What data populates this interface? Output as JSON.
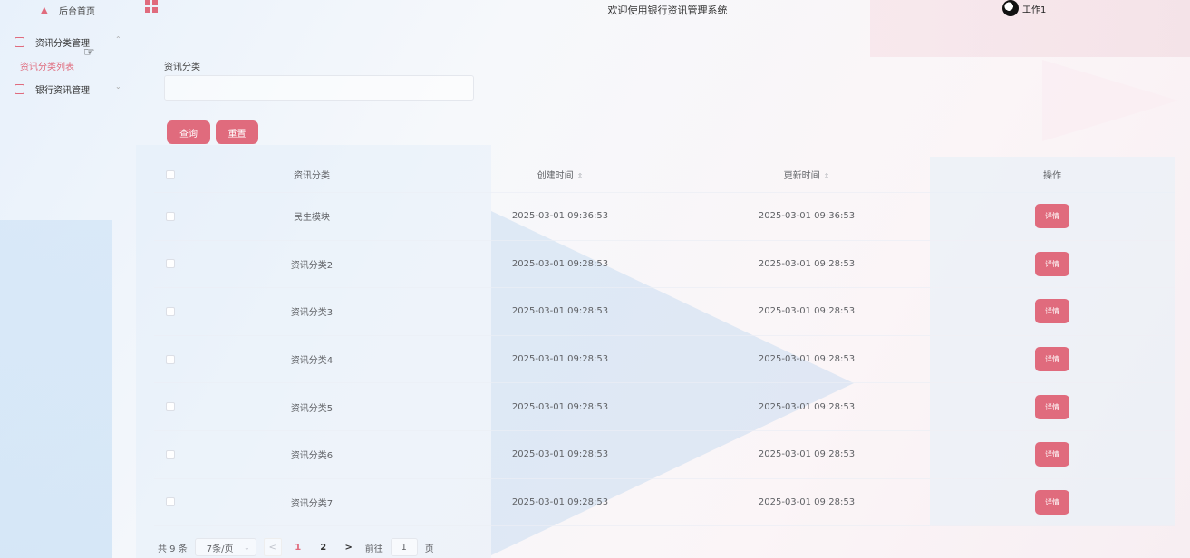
{
  "header": {
    "home_label": "后台首页",
    "site_title": "欢迎使用银行资讯管理系统",
    "user_name": "工作1"
  },
  "sidebar": {
    "items": [
      {
        "label": "资讯分类管理",
        "expanded": true,
        "children": [
          {
            "label": "资讯分类列表",
            "active": true
          }
        ]
      },
      {
        "label": "银行资讯管理",
        "expanded": false
      }
    ]
  },
  "search": {
    "label": "资讯分类",
    "value": "",
    "placeholder": ""
  },
  "buttons": {
    "query": "查询",
    "reset": "重置"
  },
  "table": {
    "columns": [
      "资讯分类",
      "创建时间",
      "更新时间",
      "操作"
    ],
    "sortable": [
      "创建时间",
      "更新时间"
    ],
    "detail_label": "详情",
    "rows": [
      {
        "category": "民生模块",
        "created": "2025-03-01 09:36:53",
        "updated": "2025-03-01 09:36:53"
      },
      {
        "category": "资讯分类2",
        "created": "2025-03-01 09:28:53",
        "updated": "2025-03-01 09:28:53"
      },
      {
        "category": "资讯分类3",
        "created": "2025-03-01 09:28:53",
        "updated": "2025-03-01 09:28:53"
      },
      {
        "category": "资讯分类4",
        "created": "2025-03-01 09:28:53",
        "updated": "2025-03-01 09:28:53"
      },
      {
        "category": "资讯分类5",
        "created": "2025-03-01 09:28:53",
        "updated": "2025-03-01 09:28:53"
      },
      {
        "category": "资讯分类6",
        "created": "2025-03-01 09:28:53",
        "updated": "2025-03-01 09:28:53"
      },
      {
        "category": "资讯分类7",
        "created": "2025-03-01 09:28:53",
        "updated": "2025-03-01 09:28:53"
      }
    ]
  },
  "pagination": {
    "total_text": "共 9 条",
    "page_size": "7条/页",
    "prev": "<",
    "pages": [
      "1",
      "2"
    ],
    "current_page": "1",
    "next": ">",
    "goto_label": "前往",
    "goto_value": "1",
    "page_suffix": "页"
  },
  "colors": {
    "accent": "#e06b7d",
    "header_text": "#909399"
  },
  "icons": {
    "home": "home-icon",
    "menu_toggle": "grid-icon",
    "menu_item": "folder-icon",
    "sort": "sort-icon",
    "cursor": "hand-pointer-icon"
  }
}
